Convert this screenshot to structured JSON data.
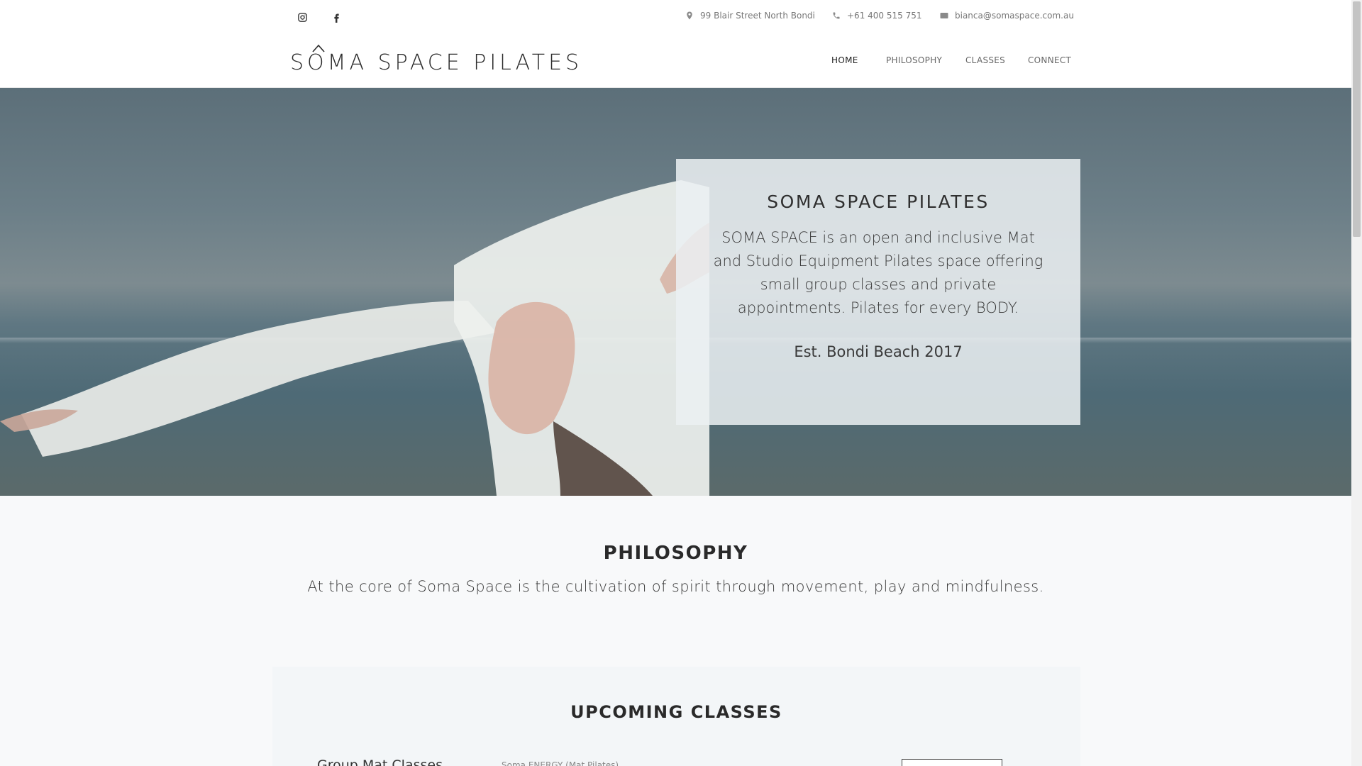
{
  "topbar": {
    "social": [
      {
        "icon": "instagram-icon"
      },
      {
        "icon": "facebook-icon"
      }
    ],
    "address": "99 Blair Street North Bondi",
    "phone": "+61 400 515 751",
    "email": "bianca@somaspace.com.au"
  },
  "header": {
    "logo_text": "SOMA SPACE PILATES",
    "nav": [
      {
        "label": "HOME",
        "active": true
      },
      {
        "label": "PHILOSOPHY",
        "active": false
      },
      {
        "label": "CLASSES",
        "active": false
      },
      {
        "label": "CONNECT",
        "active": false
      }
    ]
  },
  "hero": {
    "title": "SOMA SPACE PILATES",
    "body": "SOMA SPACE is an open and inclusive Mat and Studio Equipment Pilates space offering small group classes and private appointments. Pilates for every BODY.",
    "established": "Est. Bondi Beach 2017"
  },
  "philosophy": {
    "title": "PHILOSOPHY",
    "text": "At the core of Soma Space is the cultivation of spirit through movement, play and mindfulness."
  },
  "classes": {
    "title": "UPCOMING CLASSES",
    "first_class_name": "Group Mat Classes",
    "first_class_desc": "Soma ENERGY (Mat Pilates)"
  }
}
